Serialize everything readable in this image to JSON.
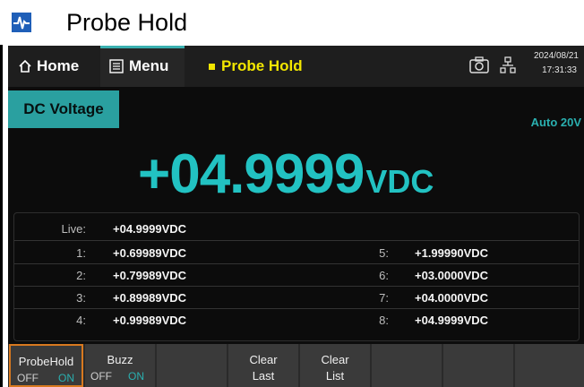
{
  "page": {
    "title": "Probe Hold",
    "icon": "waveform-icon"
  },
  "topbar": {
    "home_label": "Home",
    "menu_label": "Menu",
    "mode_title": "Probe Hold",
    "date": "2024/08/21",
    "time": "17:31:33",
    "icons": [
      "home-icon",
      "menu-icon",
      "camera-icon",
      "network-icon"
    ]
  },
  "measure": {
    "function_label": "DC Voltage",
    "range_label": "Auto 20V",
    "reading_value": "+04.9999",
    "reading_unit": "VDC"
  },
  "log": {
    "live_label": "Live:",
    "live_value": "+04.9999VDC",
    "entries_left": [
      {
        "index": "1:",
        "value": "+0.69989VDC"
      },
      {
        "index": "2:",
        "value": "+0.79989VDC"
      },
      {
        "index": "3:",
        "value": "+0.89989VDC"
      },
      {
        "index": "4:",
        "value": "+0.99989VDC"
      }
    ],
    "entries_right": [
      {
        "index": "5:",
        "value": "+1.99990VDC"
      },
      {
        "index": "6:",
        "value": "+03.0000VDC"
      },
      {
        "index": "7:",
        "value": "+04.0000VDC"
      },
      {
        "index": "8:",
        "value": "+04.9999VDC"
      }
    ]
  },
  "softkeys": {
    "probehold_label": "ProbeHold",
    "probehold_off": "OFF",
    "probehold_on": "ON",
    "buzz_label": "Buzz",
    "buzz_off": "OFF",
    "buzz_on": "ON",
    "clear_last_1": "Clear",
    "clear_last_2": "Last",
    "clear_list_1": "Clear",
    "clear_list_2": "List"
  },
  "colors": {
    "accent": "#2aa0a0",
    "mode": "#f2e600",
    "selected_border": "#d8791f"
  }
}
